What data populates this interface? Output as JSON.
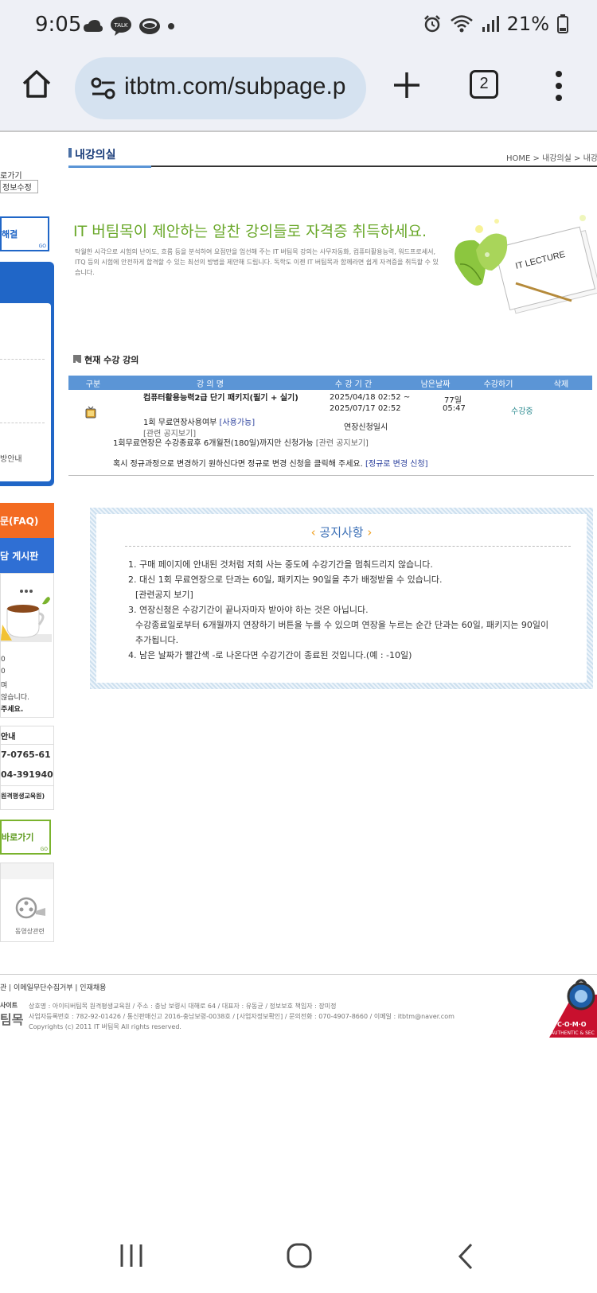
{
  "status_bar": {
    "time": "9:05",
    "battery": "21%"
  },
  "browser": {
    "url": "itbtm.com/subpage.p",
    "tab_count": "2"
  },
  "sidebar": {
    "link1": "로가기",
    "link2": "정보수정",
    "banner1": "해결",
    "banner1_go": "GO",
    "item_guide": "방안내",
    "faq": "문(FAQ)",
    "board": "담 게시판",
    "notes": [
      "0",
      "0",
      "며",
      "않습니다.",
      "주세요."
    ],
    "contact_title": "안내",
    "phone1": "7-0765-61",
    "phone2": "04-391940",
    "contact_org": "원격평생교육원)",
    "banner2": "바로가기",
    "banner2_go": "GO",
    "video_label": "동영상관련"
  },
  "page": {
    "title": "내강의실",
    "breadcrumb": "HOME > 내강의실 > 내강",
    "headline": "IT 버팀목이 제안하는 알찬 강의들로 자격증 취득하세요.",
    "intro": "탁월한 시각으로 시험의 난이도, 흐름 등을 분석하여 요점만을 엄선해 주는 IT 버팀목 강의는 사무자동화, 컴퓨터활용능력, 워드프로세서, ITQ 등의 시험에 안전하게 합격할 수 있는 최선의 방법을 제안해 드립니다. 독학도 이젠 IT 버팀목과 함께라면 쉽게 자격증을 취득할 수 있습니다.",
    "lecture_card_label": "IT LECTURE",
    "section_title": "현재 수강 강의"
  },
  "course_table": {
    "headers": [
      "구분",
      "강 의 명",
      "수 강 기 간",
      "남은날짜",
      "수강하기",
      "삭제"
    ],
    "row": {
      "name": "컴퓨터활용능력2급 단기 패키지(필기 + 실기)",
      "free_ext_label": "1회 무료연장사용여부",
      "free_ext_status": "[사용가능]",
      "notice_link": "[관련 공지보기]",
      "period_start": "2025/04/18 02:52 ~",
      "period_end": "2025/07/17 02:52",
      "remaining_days": "77일",
      "remaining_time": "05:47",
      "status": "수강중",
      "ext_apply_date": "연장신청일시"
    },
    "note1": "1회무료연장은 수강종료후 6개월전(180일)까지만 신청가능",
    "note1_link": "[관련 공지보기]",
    "note2": "혹시 정규과정으로 변경하기 원하신다면 정규로 변경 신청을 클릭해 주세요.",
    "note2_link": "[정규로 변경 신청]"
  },
  "notice": {
    "title": "공지사항",
    "items": [
      "1. 구매 페이지에 안내된 것처럼 저희 사는 중도에 수강기간을 멈춰드리지 않습니다.",
      "2. 대신 1회 무료연장으로 단과는 60일, 패키지는 90일을 추가 배정받을 수 있습니다.",
      "[관련공지 보기]",
      "3. 연장신청은 수강기간이 끝나자마자 받아야 하는 것은 아닙니다.",
      "수강종료일로부터 6개월까지 연장하기 버튼을 누를 수 있으며 연장을 누르는 순간 단과는 60일, 패키지는 90일이",
      "추가됩니다.",
      "4. 남은 날짜가 빨간색 -로 나온다면 수강기간이 종료된 것입니다.(예 : -10일)"
    ]
  },
  "footer": {
    "links": "관 | 이메일무단수집거부 | 인재채용",
    "site_label": "사이트",
    "brand": "팀목",
    "line1": "상호명 : 아이티버팀목 원격평생교육원 / 주소 : 충남 보령시 대해로 64 / 대표자 : 유동균 / 정보보호 책임자 : 장미정",
    "line2": "사업자등록번호 : 782-92-01426 / 통신판매신고 2016-충남보령-0038호 / [사업자정보확인] / 문의전화 : 070-4907-8660 / 이메일 : itbtm@naver.com",
    "copyright": "Copyrights (c) 2011 IT 버팀목 All rights reserved.",
    "comodo_brand": "C·O·M·O",
    "comodo_sub": "AUTHENTIC & SEC"
  },
  "colors": {
    "blue": "#2066c7",
    "green": "#7ab32d",
    "orange": "#f36b21",
    "header_blue": "#5b95d6"
  }
}
